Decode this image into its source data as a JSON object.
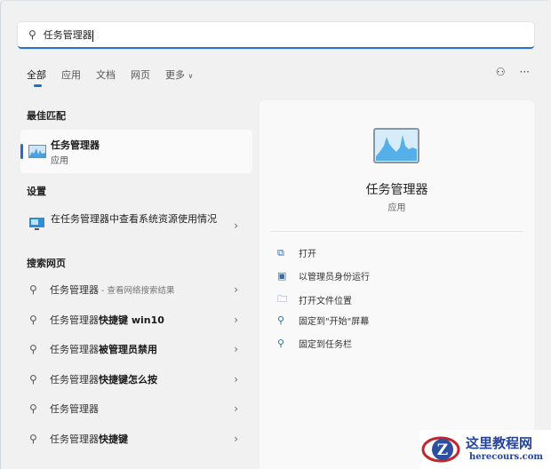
{
  "search": {
    "value": "任务管理器"
  },
  "tabs": [
    "全部",
    "应用",
    "文档",
    "网页",
    "更多"
  ],
  "sections": {
    "best": "最佳匹配",
    "settings": "设置",
    "web": "搜索网页"
  },
  "best_match": {
    "title": "任务管理器",
    "subtitle": "应用"
  },
  "setting_item": {
    "label": "在任务管理器中查看系统资源使用情况"
  },
  "web_results": [
    {
      "prefix": "任务管理器",
      "bold": "",
      "suffix": " - 查看网络搜索结果"
    },
    {
      "prefix": "任务管理器",
      "bold": "快捷键 win10",
      "suffix": ""
    },
    {
      "prefix": "任务管理器",
      "bold": "被管理员禁用",
      "suffix": ""
    },
    {
      "prefix": "任务管理器",
      "bold": "快捷键怎么按",
      "suffix": ""
    },
    {
      "prefix": "任务管理器",
      "bold": "",
      "suffix": ""
    },
    {
      "prefix": "任务管理器",
      "bold": "快捷键",
      "suffix": ""
    }
  ],
  "detail": {
    "title": "任务管理器",
    "subtitle": "应用",
    "actions": [
      "打开",
      "以管理员身份运行",
      "打开文件位置",
      "固定到\"开始\"屏幕",
      "固定到任务栏"
    ]
  },
  "watermark": {
    "name": "这里教程网",
    "url": "herecours.com"
  },
  "colors": {
    "accent": "#1f6fc9"
  }
}
